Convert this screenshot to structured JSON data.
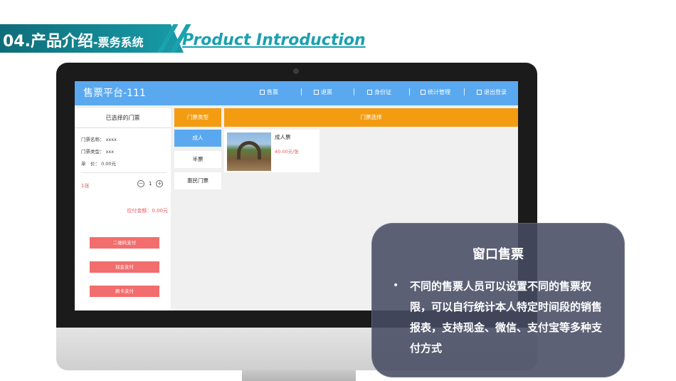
{
  "slide": {
    "title_main": "04.产品介绍",
    "title_sub": "-票务系统",
    "title_en": "Product Introduction"
  },
  "app": {
    "title": "售票平台-111",
    "header_color": "#5aa9f0",
    "accent_color": "#f39c12",
    "danger_color": "#f26d6d",
    "nav": [
      {
        "label": "售票",
        "icon": "ticket-icon"
      },
      {
        "label": "退票",
        "icon": "refund-icon"
      },
      {
        "label": "身份证",
        "icon": "id-card-icon"
      },
      {
        "label": "统计管理",
        "icon": "chart-icon"
      },
      {
        "label": "退出登录",
        "icon": "logout-icon"
      }
    ]
  },
  "left_panel": {
    "heading": "已选择的门票",
    "ticket_name_label": "门票名称：",
    "ticket_name_value": "xxxx",
    "ticket_type_label": "门票类型：",
    "ticket_type_value": "xxx",
    "unit_price_label": "单　价：",
    "unit_price_value": "0.00元",
    "quantity_text": "1张",
    "stepper_value": "1",
    "total_text": "应付金额：0.00元",
    "pay_buttons": [
      "二维码支付",
      "现金支付",
      "刷卡支付"
    ]
  },
  "ticket_types": {
    "heading": "门票类型",
    "items": [
      "成人",
      "半票",
      "惠民门票"
    ],
    "active_index": 0
  },
  "ticket_selection": {
    "heading": "门票选择",
    "cards": [
      {
        "name": "成人票",
        "price": "40.00元/张"
      }
    ]
  },
  "callout": {
    "title": "窗口售票",
    "bullet": "•",
    "body": "不同的售票人员可以设置不同的售票权限，可以自行统计本人特定时间段的销售报表，支持现金、微信、支付宝等多种支付方式"
  }
}
